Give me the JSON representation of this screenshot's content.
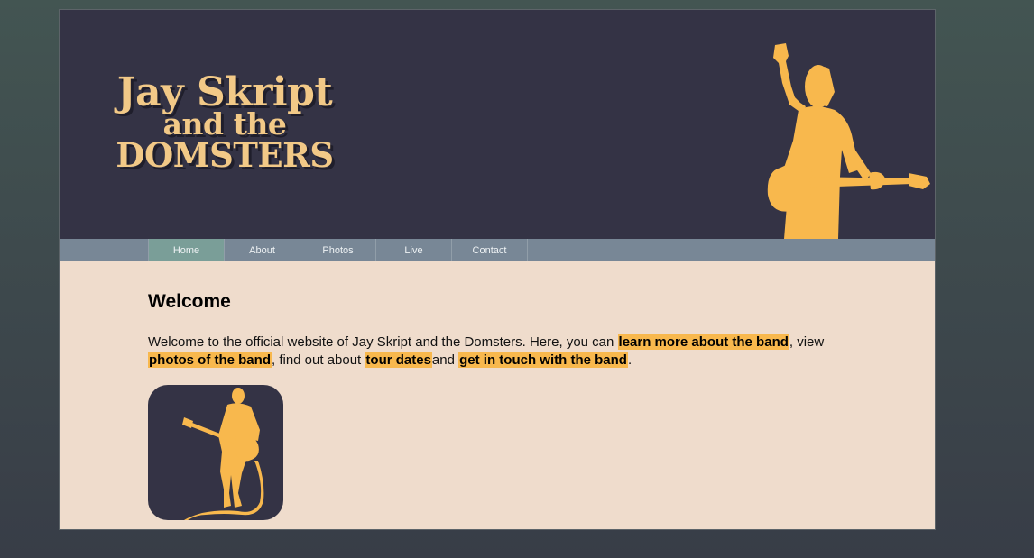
{
  "header": {
    "logo": {
      "line1": "Jay Skript",
      "line2": "and the",
      "line3": "DOMSTERS"
    }
  },
  "nav": {
    "items": [
      {
        "label": "Home",
        "active": true
      },
      {
        "label": "About",
        "active": false
      },
      {
        "label": "Photos",
        "active": false
      },
      {
        "label": "Live",
        "active": false
      },
      {
        "label": "Contact",
        "active": false
      }
    ]
  },
  "main": {
    "title": "Welcome",
    "intro": {
      "text1": "Welcome to the official website of Jay Skript and the Domsters. Here, you can ",
      "link1": "learn more about the band",
      "text2": ", view ",
      "link2": "photos of the band",
      "text3": ", find out about ",
      "link3": "tour dates",
      "text4": "and ",
      "link4": "get in touch with the band",
      "text5": "."
    }
  },
  "colors": {
    "header_bg": "#343345",
    "accent": "#f8b84d",
    "nav_bg": "#788796",
    "nav_active": "#7a9e98",
    "content_bg": "#efdccc"
  },
  "icons": {
    "hero": "guitarist-silhouette-icon",
    "thumb": "guitarist-silhouette-icon"
  }
}
